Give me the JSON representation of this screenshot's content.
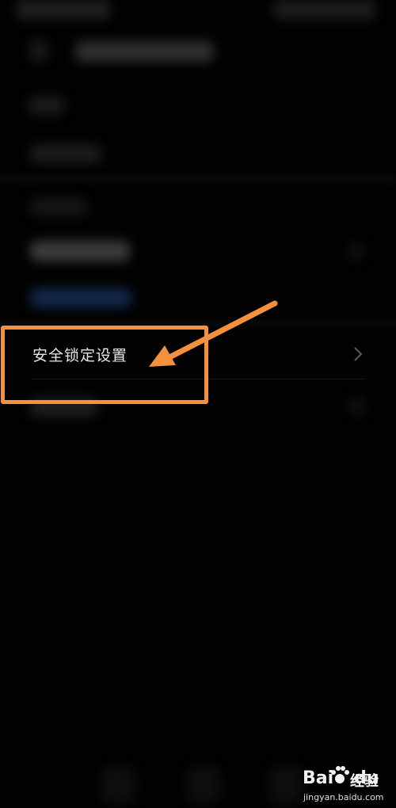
{
  "setting_item": {
    "label": "安全锁定设置"
  },
  "icons": {
    "row_chevron": "chevron-right-icon",
    "annotation_arrow": "arrow-icon"
  },
  "annotation": {
    "color": "#f5903e"
  },
  "watermark": {
    "brand_latin": "Bai",
    "brand_latin_tail": "du",
    "brand_cn": "经验",
    "url": "jingyan.baidu.com"
  },
  "colors": {
    "background": "#020202",
    "text": "#e8e8e8",
    "blurred_link": "#13294a"
  }
}
